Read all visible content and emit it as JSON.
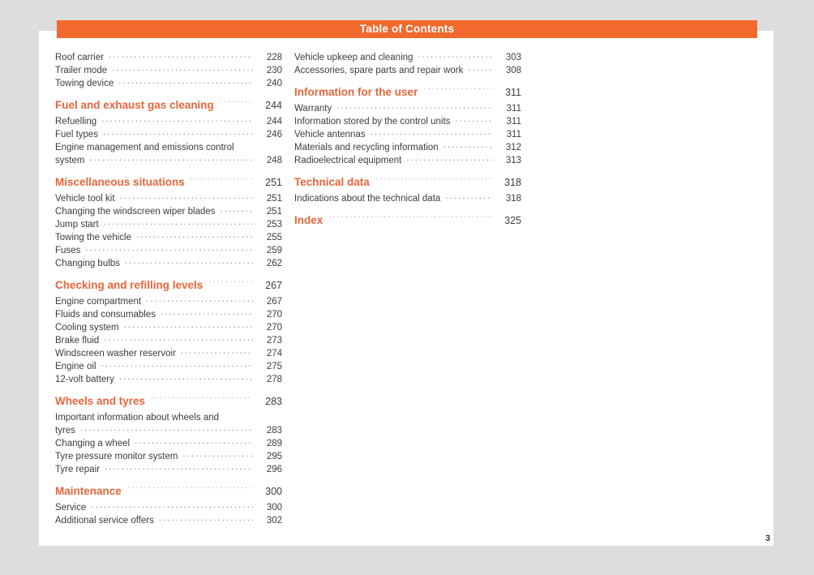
{
  "header": {
    "title": "Table of Contents",
    "bar_color": "#f2692e",
    "title_color": "#ffffff"
  },
  "colors": {
    "background": "#dddddd",
    "page": "#ffffff",
    "accent_orange": "#f2692e",
    "heading_orange": "#e8653a",
    "body_text": "#3c3c3c",
    "dot_leader": "#8c8c8c"
  },
  "folio": {
    "page_number": "3"
  },
  "left_column": [
    {
      "label": "Roof carrier",
      "page": "228",
      "type": "entry"
    },
    {
      "label": "Trailer mode",
      "page": "230",
      "type": "entry"
    },
    {
      "label": "Towing device",
      "page": "240",
      "type": "entry"
    },
    {
      "type": "gap"
    },
    {
      "label": "Fuel and exhaust gas cleaning",
      "page": "244",
      "type": "heading"
    },
    {
      "label": "Refuelling",
      "page": "244",
      "type": "entry"
    },
    {
      "label": "Fuel types",
      "page": "246",
      "type": "entry"
    },
    {
      "label": "Engine management and emissions control",
      "page": "",
      "type": "continuation"
    },
    {
      "label": "system",
      "page": "248",
      "type": "entry"
    },
    {
      "type": "gap"
    },
    {
      "label": "Miscellaneous situations",
      "page": "251",
      "type": "heading"
    },
    {
      "label": "Vehicle tool kit",
      "page": "251",
      "type": "entry"
    },
    {
      "label": "Changing the windscreen wiper blades",
      "page": "251",
      "type": "entry"
    },
    {
      "label": "Jump start",
      "page": "253",
      "type": "entry"
    },
    {
      "label": "Towing the vehicle",
      "page": "255",
      "type": "entry"
    },
    {
      "label": "Fuses",
      "page": "259",
      "type": "entry"
    },
    {
      "label": "Changing bulbs",
      "page": "262",
      "type": "entry"
    },
    {
      "type": "gap"
    },
    {
      "label": "Checking and refilling levels",
      "page": "267",
      "type": "heading"
    },
    {
      "label": "Engine compartment",
      "page": "267",
      "type": "entry"
    },
    {
      "label": "Fluids and consumables",
      "page": "270",
      "type": "entry"
    },
    {
      "label": "Cooling system",
      "page": "270",
      "type": "entry"
    },
    {
      "label": "Brake fluid",
      "page": "273",
      "type": "entry"
    },
    {
      "label": "Windscreen washer reservoir",
      "page": "274",
      "type": "entry"
    },
    {
      "label": "Engine oil",
      "page": "275",
      "type": "entry"
    },
    {
      "label": "12-volt battery",
      "page": "278",
      "type": "entry"
    },
    {
      "type": "gap"
    },
    {
      "label": "Wheels and tyres",
      "page": "283",
      "type": "heading"
    },
    {
      "label": "Important information about wheels and",
      "page": "",
      "type": "continuation"
    },
    {
      "label": "tyres",
      "page": "283",
      "type": "entry"
    },
    {
      "label": "Changing a wheel",
      "page": "289",
      "type": "entry"
    },
    {
      "label": "Tyre pressure monitor system",
      "page": "295",
      "type": "entry"
    },
    {
      "label": "Tyre repair",
      "page": "296",
      "type": "entry"
    },
    {
      "type": "gap"
    },
    {
      "label": "Maintenance",
      "page": "300",
      "type": "heading"
    },
    {
      "label": "Service",
      "page": "300",
      "type": "entry"
    },
    {
      "label": "Additional service offers",
      "page": "302",
      "type": "entry"
    }
  ],
  "right_column": [
    {
      "label": "Vehicle upkeep and cleaning",
      "page": "303",
      "type": "entry"
    },
    {
      "label": "Accessories, spare parts and repair work",
      "page": "308",
      "type": "entry"
    },
    {
      "type": "gap"
    },
    {
      "label": "Information for the user",
      "page": "311",
      "type": "heading"
    },
    {
      "label": "Warranty",
      "page": "311",
      "type": "entry"
    },
    {
      "label": "Information stored by the control units",
      "page": "311",
      "type": "entry"
    },
    {
      "label": "Vehicle antennas",
      "page": "311",
      "type": "entry"
    },
    {
      "label": "Materials and recycling information",
      "page": "312",
      "type": "entry"
    },
    {
      "label": "Radioelectrical equipment",
      "page": "313",
      "type": "entry"
    },
    {
      "type": "gap"
    },
    {
      "label": "Technical data",
      "page": "318",
      "type": "heading"
    },
    {
      "label": "Indications about the technical data",
      "page": "318",
      "type": "entry"
    },
    {
      "type": "gap"
    },
    {
      "label": "Index",
      "page": "325",
      "type": "heading"
    }
  ]
}
